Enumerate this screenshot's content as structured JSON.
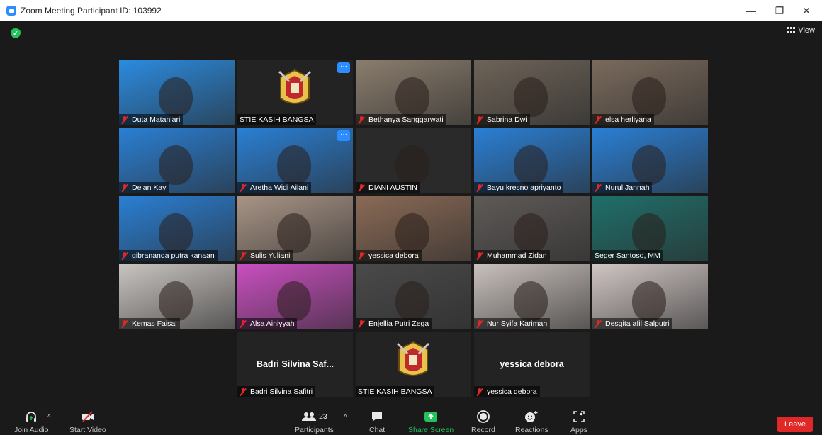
{
  "window": {
    "title": "Zoom Meeting Participant ID: 103992",
    "minimize_glyph": "—",
    "restore_glyph": "❐",
    "close_glyph": "✕"
  },
  "view_button": {
    "label": "View"
  },
  "participants": [
    {
      "name": "Duta Mataniari",
      "muted": true,
      "bg": "#2b8be0"
    },
    {
      "name": "STIE KASIH BANGSA",
      "muted": false,
      "bg": "#1d1d1d",
      "crest": true,
      "more": true
    },
    {
      "name": "Bethanya Sanggarwati",
      "muted": true,
      "bg": "#8a7d6d"
    },
    {
      "name": "Sabrina Dwi",
      "muted": true,
      "bg": "#6d6358"
    },
    {
      "name": "elsa herliyana",
      "muted": true,
      "bg": "#7a6a5c"
    },
    {
      "name": "Delan Kay",
      "muted": true,
      "bg": "#2a7fd4"
    },
    {
      "name": "Aretha Widi Ailani",
      "muted": true,
      "bg": "#2a7fd4",
      "more": true
    },
    {
      "name": "DIANI AUSTIN",
      "muted": true,
      "bg": "#2a2a2a"
    },
    {
      "name": "Bayu kresno apriyanto",
      "muted": true,
      "bg": "#2a7fd4"
    },
    {
      "name": "Nurul Jannah",
      "muted": true,
      "bg": "#2a7fd4"
    },
    {
      "name": "gibrananda putra kanaan",
      "muted": true,
      "bg": "#2a7fd4"
    },
    {
      "name": "Sulis Yuliani",
      "muted": true,
      "bg": "#a89486"
    },
    {
      "name": "yessica debora",
      "muted": true,
      "bg": "#8a6a56"
    },
    {
      "name": "Muhammad Zidan",
      "muted": true,
      "bg": "#5e5a58"
    },
    {
      "name": "Seger Santoso, MM",
      "muted": false,
      "bg": "#1f6f6a",
      "active": true
    },
    {
      "name": "Kemas Faisal",
      "muted": true,
      "bg": "#c9c4c0"
    },
    {
      "name": "Alsa Ainiyyah",
      "muted": true,
      "bg": "#c94fc0"
    },
    {
      "name": "Enjellia Putri Zega",
      "muted": true,
      "bg": "#4a4a4a"
    },
    {
      "name": "Nur Syifa Karimah",
      "muted": true,
      "bg": "#c8c0bc"
    },
    {
      "name": "Desgita afil Salputri",
      "muted": true,
      "bg": "#d0c6c4"
    },
    {
      "name": "Badri Silvina Safitri",
      "muted": true,
      "bg": "#232323",
      "display_name": "Badri Silvina Saf..."
    },
    {
      "name": "STIE KASIH BANGSA",
      "muted": false,
      "bg": "#1d1d1d",
      "crest": true
    },
    {
      "name": "yessica debora",
      "muted": true,
      "bg": "#232323",
      "display_name": "yessica debora"
    }
  ],
  "toolbar": {
    "join_audio": "Join Audio",
    "start_video": "Start Video",
    "participants_label": "Participants",
    "participants_count": "23",
    "chat": "Chat",
    "share_screen": "Share Screen",
    "record": "Record",
    "reactions": "Reactions",
    "apps": "Apps",
    "leave": "Leave"
  },
  "colors": {
    "accent": "#2d8cff",
    "share": "#23c25a",
    "leave": "#e02828",
    "active_speaker": "#d5e36f"
  }
}
